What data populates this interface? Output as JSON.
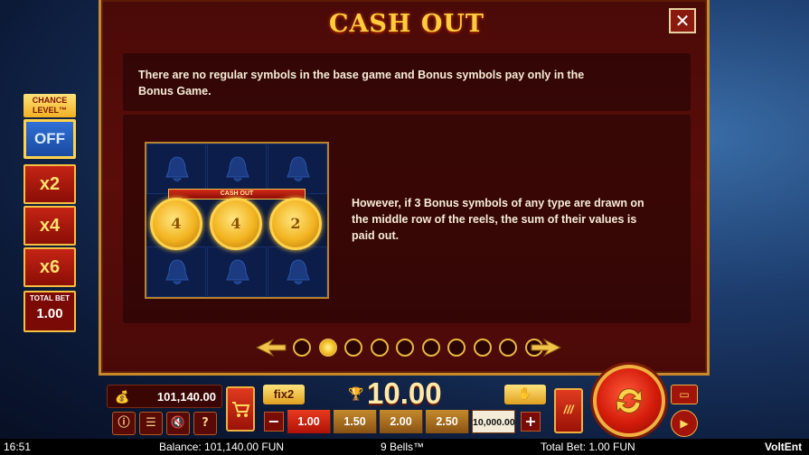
{
  "chance_level": {
    "title": "CHANCE LEVEL™",
    "options": [
      "OFF",
      "x2",
      "x4",
      "x6"
    ],
    "selected": "OFF",
    "total_bet_label": "TOTAL BET",
    "total_bet_value": "1.00"
  },
  "panel": {
    "title": "CASH OUT",
    "close_icon": "✕",
    "intro_text": "There are no regular symbols in the base game and Bonus symbols pay only in the Bonus Game.",
    "description": "However, if 3 Bonus symbols of any type are drawn on the middle row of the reels, the sum of their values is paid out.",
    "reels": {
      "banner": "CASH OUT",
      "coin_values": [
        "4",
        "4",
        "2"
      ],
      "symbol": "bell-icon"
    }
  },
  "pagination": {
    "total_pages": 10,
    "current_page": 2
  },
  "bottom_bar": {
    "balance": "101,140.00",
    "balance_icon": "💰",
    "fix_label": "fix2",
    "win_value": "10.00",
    "bet_options": [
      "1.00",
      "1.50",
      "2.00",
      "2.50",
      "10,000.00"
    ],
    "selected_bet": "1.00",
    "minus": "−",
    "plus": "+",
    "turbo_label": "///",
    "buttons": {
      "info": "ⓘ",
      "menu": "☰",
      "sound": "🔇",
      "help": "?"
    }
  },
  "status_bar": {
    "time": "16:51",
    "balance_text": "Balance: 101,140.00 FUN",
    "game_title": "9 Bells™",
    "total_bet_text": "Total Bet: 1.00 FUN",
    "brand": "VoltEnt"
  },
  "colors": {
    "panel_bg": "#4a0a08",
    "gold": "#ffcc3d",
    "accent_red": "#d31c0a",
    "chance_active": "#2f6fd6"
  }
}
